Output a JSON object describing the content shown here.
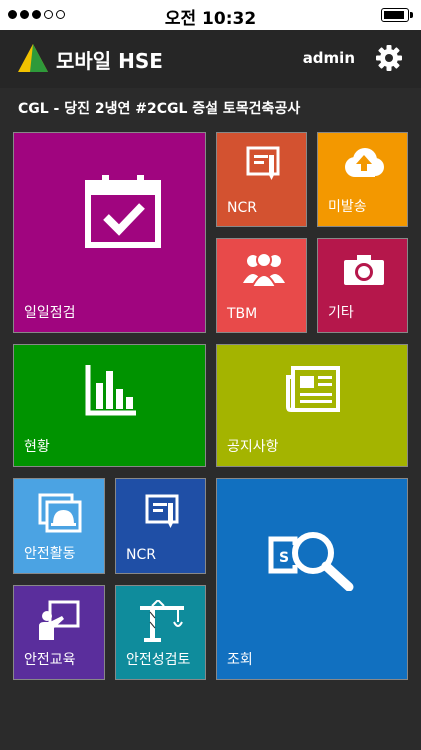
{
  "status": {
    "time": "오전 10:32"
  },
  "header": {
    "title": "모바일 HSE",
    "user": "admin"
  },
  "site": {
    "name": "CGL - 당진 2냉연 #2CGL 증설 토목건축공사"
  },
  "tiles": {
    "daily_check": {
      "label": "일일점검",
      "color": "#a0057f"
    },
    "ncr_top": {
      "label": "NCR",
      "color": "#d35230"
    },
    "unsent": {
      "label": "미발송",
      "color": "#f39800"
    },
    "tbm": {
      "label": "TBM",
      "color": "#e84a4a"
    },
    "etc": {
      "label": "기타",
      "color": "#b5174b"
    },
    "status": {
      "label": "현황",
      "color": "#009300"
    },
    "notice": {
      "label": "공지사항",
      "color": "#a4b400"
    },
    "safety_activity": {
      "label": "안전활동",
      "color": "#4ba3e3"
    },
    "ncr_bottom": {
      "label": "NCR",
      "color": "#1f4fa6"
    },
    "search": {
      "label": "조회",
      "color": "#1170c0"
    },
    "safety_edu": {
      "label": "안전교육",
      "color": "#5a2e9c"
    },
    "safety_review": {
      "label": "안전성검토",
      "color": "#0f8c9c"
    }
  }
}
